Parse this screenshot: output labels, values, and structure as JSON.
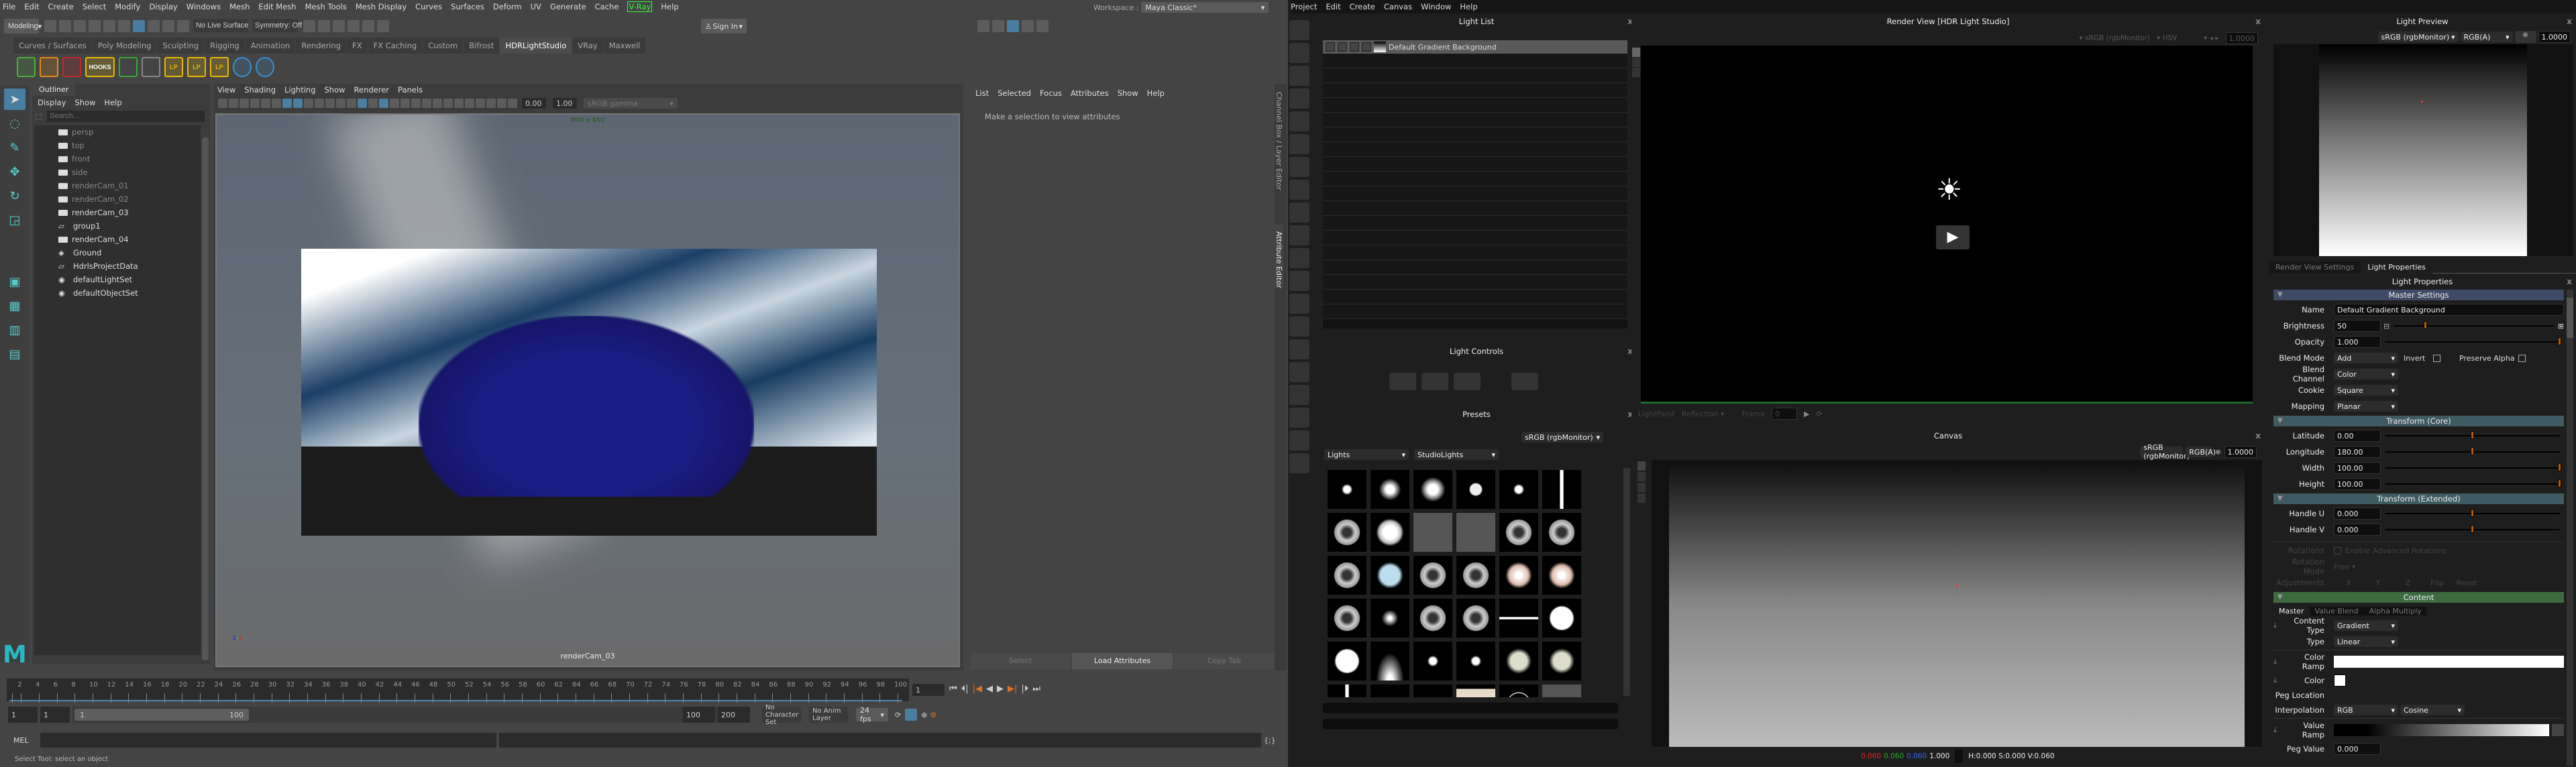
{
  "maya": {
    "menu": [
      "File",
      "Edit",
      "Create",
      "Select",
      "Modify",
      "Display",
      "Windows",
      "Mesh",
      "Edit Mesh",
      "Mesh Tools",
      "Mesh Display",
      "Curves",
      "Surfaces",
      "Deform",
      "UV",
      "Generate",
      "Cache",
      "V-Ray",
      "Help"
    ],
    "workspace_label": "Workspace :",
    "workspace_value": "Maya Classic*",
    "mode": "Modeling",
    "live_surface": "No Live Surface",
    "symmetry": "Symmetry: Off",
    "sign_in": "Sign In",
    "shelf_tabs": [
      "Curves / Surfaces",
      "Poly Modeling",
      "Sculpting",
      "Rigging",
      "Animation",
      "Rendering",
      "FX",
      "FX Caching",
      "Custom",
      "Bifrost",
      "HDRLightStudio",
      "VRay",
      "Maxwell"
    ],
    "active_shelf": "HDRLightStudio",
    "shelf_icons": [
      "play-icon",
      "pause-icon",
      "stop-icon",
      "hooks-icon",
      "send-icon",
      "lightpaint-clear-icon",
      "lightpaint-icon",
      "lightpaint-icon",
      "lightpaint-icon",
      "help-icon",
      "info-icon"
    ],
    "hooks_label": "HOOKS",
    "lp_label": "LP",
    "outliner": {
      "title": "Outliner",
      "menu": [
        "Display",
        "Show",
        "Help"
      ],
      "search_placeholder": "Search...",
      "items": [
        {
          "label": "persp",
          "icon": "camera",
          "dim": true
        },
        {
          "label": "top",
          "icon": "camera",
          "dim": true
        },
        {
          "label": "front",
          "icon": "camera",
          "dim": true
        },
        {
          "label": "side",
          "icon": "camera",
          "dim": true
        },
        {
          "label": "renderCam_01",
          "icon": "camera",
          "dim": true
        },
        {
          "label": "renderCam_02",
          "icon": "camera",
          "dim": true
        },
        {
          "label": "renderCam_03",
          "icon": "camera",
          "dim": false
        },
        {
          "label": "group1",
          "icon": "group",
          "dim": false
        },
        {
          "label": "renderCam_04",
          "icon": "camera",
          "dim": false
        },
        {
          "label": "Ground",
          "icon": "mesh",
          "dim": false
        },
        {
          "label": "HdrlsProjectData",
          "icon": "group",
          "dim": false
        },
        {
          "label": "defaultLightSet",
          "icon": "set",
          "dim": false
        },
        {
          "label": "defaultObjectSet",
          "icon": "set",
          "dim": false
        }
      ]
    },
    "viewport": {
      "menu": [
        "View",
        "Shading",
        "Lighting",
        "Show",
        "Renderer",
        "Panels"
      ],
      "exposure": "0.00",
      "gamma": "1.00",
      "color_space": "sRGB gamma",
      "resolution": "900 x 450",
      "camera": "renderCam_03"
    },
    "attr_editor": {
      "menu": [
        "List",
        "Selected",
        "Focus",
        "Attributes",
        "Show",
        "Help"
      ],
      "message": "Make a selection to view attributes",
      "buttons": [
        "Select",
        "Load Attributes",
        "Copy Tab"
      ]
    },
    "side_tabs": [
      "Channel Box / Layer Editor",
      "Attribute Editor"
    ],
    "timeline": {
      "start": 1,
      "end": 100,
      "step": 2,
      "current": "1"
    },
    "range": {
      "start": "1",
      "inner_start": "1",
      "slider_start": "1",
      "slider_end": "100",
      "inner_end": "100",
      "end": "200"
    },
    "character_set": "No Character Set",
    "anim_layer": "No Anim Layer",
    "fps": "24 fps",
    "mel_label": "MEL",
    "help_line": "Select Tool: select an object"
  },
  "hdr": {
    "menu": [
      "Project",
      "Edit",
      "Create",
      "Canvas",
      "Window",
      "Help"
    ],
    "light_list": {
      "title": "Light List",
      "items": [
        {
          "name": "Default Gradient Background"
        }
      ]
    },
    "light_controls": {
      "title": "Light Controls"
    },
    "presets": {
      "title": "Presets",
      "color_space": "sRGB (rgbMonitor)",
      "category": "Lights",
      "subcategory": "StudioLights",
      "thumbs": [
        "dot",
        "softdot",
        "glow",
        "smiley",
        "dot",
        "strip",
        "ring",
        "softbox",
        "window",
        "window",
        "ring",
        "ring",
        "ring",
        "softblue",
        "ring",
        "ring",
        "warm",
        "warm",
        "ring",
        "flare",
        "ring",
        "ring",
        "line",
        "white",
        "white",
        "fade",
        "dot",
        "dot",
        "dial",
        "dial",
        "strip",
        "fade",
        "panel",
        "warmpanel",
        "circle",
        "window"
      ]
    },
    "render_view": {
      "title": "Render View [HDR Light Studio]",
      "color_space": "sRGB (rgbMonitor)",
      "mode": "HSV",
      "value": "1.0000",
      "lightpaint": "LightPaint",
      "reflection": "Reflection",
      "frame_label": "Frame",
      "frame": "0"
    },
    "canvas": {
      "title": "Canvas",
      "color_space": "sRGB (rgbMonitor)",
      "channel": "RGB(A)",
      "value": "1.0000",
      "r": "0.060",
      "g": "0.060",
      "b": "0.060",
      "a": "1.000",
      "hsv": "H:0.000 S:0.000 V:0.060"
    },
    "light_preview": {
      "title": "Light Preview",
      "color_space": "sRGB (rgbMonitor)",
      "channel": "RGB(A)",
      "value": "1.0000"
    },
    "tabs": [
      "Render View Settings",
      "Light Properties"
    ],
    "props": {
      "title": "Light Properties",
      "master": "Master Settings",
      "name_label": "Name",
      "name": "Default Gradient Background",
      "brightness_label": "Brightness",
      "brightness": "50",
      "brightness_pos": 0.2,
      "opacity_label": "Opacity",
      "opacity": "1.000",
      "opacity_pos": 1.0,
      "blend_mode_label": "Blend Mode",
      "blend_mode": "Add",
      "invert_label": "Invert",
      "invert": false,
      "preserve_alpha_label": "Preserve Alpha",
      "preserve_alpha": false,
      "blend_channel_label": "Blend Channel",
      "blend_channel": "Color",
      "cookie_label": "Cookie",
      "cookie": "Square",
      "mapping_label": "Mapping",
      "mapping": "Planar",
      "transform_core": "Transform (Core)",
      "core": [
        {
          "label": "Latitude",
          "value": "0.00",
          "pos": 0.5
        },
        {
          "label": "Longitude",
          "value": "180.00",
          "pos": 0.5
        },
        {
          "label": "Width",
          "value": "100.00",
          "pos": 1.0
        },
        {
          "label": "Height",
          "value": "100.00",
          "pos": 1.0
        }
      ],
      "transform_ext": "Transform (Extended)",
      "ext": [
        {
          "label": "Handle U",
          "value": "0.000",
          "pos": 0.5
        },
        {
          "label": "Handle V",
          "value": "0.000",
          "pos": 0.5
        }
      ],
      "rotations_label": "Rotations",
      "enable_adv": "Enable Advanced Rotations",
      "rotation_mode_label": "Rotation Mode",
      "rotation_mode": "Free",
      "adjustments_label": "Adjustments",
      "adj": [
        "X",
        "Y",
        "Z",
        "Flip",
        "Reset"
      ],
      "content": "Content",
      "content_tabs": [
        "Master",
        "Value Blend",
        "Alpha Multiply"
      ],
      "content_type_label": "Content Type",
      "content_type": "Gradient",
      "type_label": "Type",
      "type": "Linear",
      "color_ramp_label": "Color Ramp",
      "color_label": "Color",
      "peg_location_label": "Peg Location",
      "interp_label": "Interpolation",
      "interp1": "RGB",
      "interp2": "Cosine",
      "value_ramp_label": "Value Ramp",
      "peg_value_label": "Peg Value",
      "peg_value": "0.000"
    },
    "colors": {
      "master": "#3f4a66",
      "transform": "#3f5a60",
      "content": "#3e6a40",
      "accent": "#c05a00"
    }
  }
}
